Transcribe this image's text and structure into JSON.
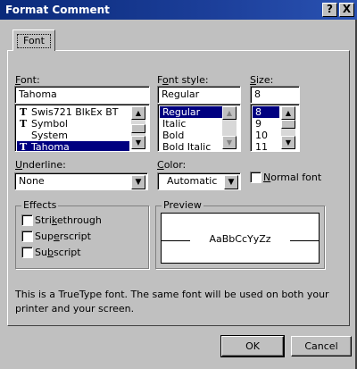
{
  "window": {
    "title": "Format Comment",
    "help_btn": "?",
    "close_btn": "X"
  },
  "tab": {
    "label": "Font"
  },
  "font": {
    "label": "Font:",
    "value": "Tahoma",
    "items": [
      {
        "icon": "truetype-icon",
        "label": "Swis721 BlkEx BT"
      },
      {
        "icon": "truetype-icon",
        "label": "Symbol"
      },
      {
        "icon": "",
        "label": "System"
      },
      {
        "icon": "truetype-icon",
        "label": "Tahoma",
        "selected": true
      }
    ]
  },
  "font_style": {
    "label": "Font style:",
    "value": "Regular",
    "items": [
      {
        "label": "Regular",
        "selected": true
      },
      {
        "label": "Italic"
      },
      {
        "label": "Bold"
      },
      {
        "label": "Bold Italic"
      }
    ]
  },
  "size": {
    "label": "Size:",
    "value": "8",
    "items": [
      {
        "label": "8",
        "selected": true
      },
      {
        "label": "9"
      },
      {
        "label": "10"
      },
      {
        "label": "11"
      }
    ]
  },
  "underline": {
    "label": "Underline:",
    "value": "None"
  },
  "color": {
    "label": "Color:",
    "value": "Automatic"
  },
  "normal_font": {
    "label": "Normal font",
    "checked": false
  },
  "effects": {
    "title": "Effects",
    "strikethrough": "Strikethrough",
    "superscript": "Superscript",
    "subscript": "Subscript"
  },
  "preview": {
    "title": "Preview",
    "sample": "AaBbCcYyZz"
  },
  "info_text": "This is a TrueType font.  The same font will be used on both your printer and your screen.",
  "buttons": {
    "ok": "OK",
    "cancel": "Cancel"
  },
  "icons": {
    "truetype": "truetype-icon",
    "scroll_up": "up-arrow-icon",
    "scroll_down": "down-arrow-icon",
    "dropdown": "chevron-down-icon"
  }
}
